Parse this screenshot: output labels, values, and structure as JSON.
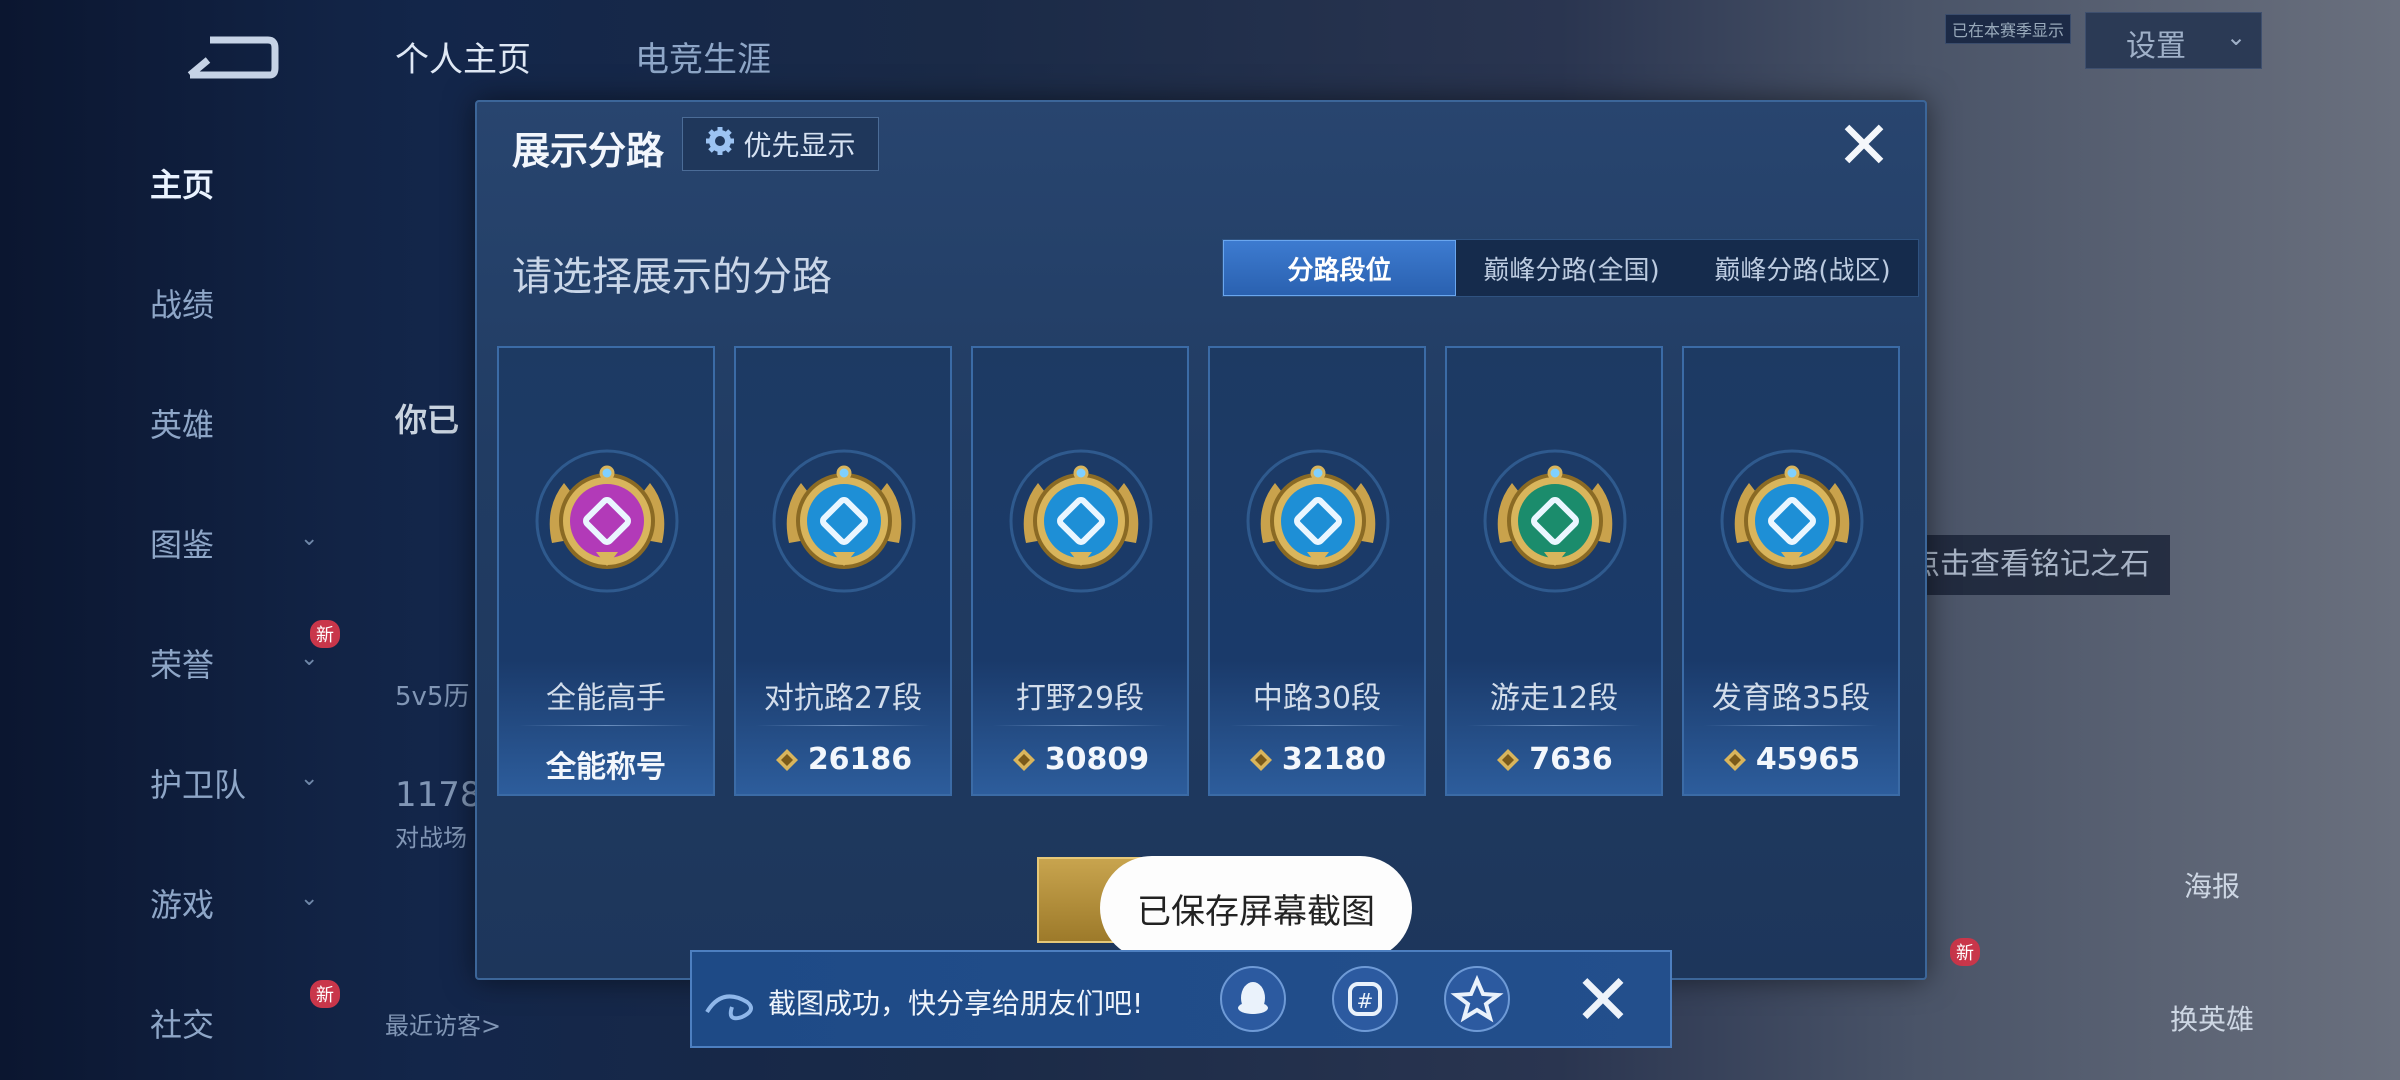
{
  "sidebar": {
    "items": [
      {
        "label": "主页",
        "active": true,
        "chevron": false
      },
      {
        "label": "战绩",
        "active": false,
        "chevron": false
      },
      {
        "label": "英雄",
        "active": false,
        "chevron": false
      },
      {
        "label": "图鉴",
        "active": false,
        "chevron": true
      },
      {
        "label": "荣誉",
        "active": false,
        "chevron": true,
        "badge": "新"
      },
      {
        "label": "护卫队",
        "active": false,
        "chevron": true
      },
      {
        "label": "游戏",
        "active": false,
        "chevron": true
      },
      {
        "label": "社交",
        "active": false,
        "chevron": false,
        "badge": "新"
      }
    ]
  },
  "header": {
    "tabs": [
      {
        "label": "个人主页"
      },
      {
        "label": "电竞生涯"
      }
    ],
    "settings_label": "设置",
    "sync_tag": "已在本赛季显示"
  },
  "background": {
    "partial_name": "你已",
    "history_label": "5v5历",
    "match_count": "1178",
    "match_label": "对战场",
    "recent_visitors": "最近访客>",
    "inscription_hint": "点击查看铭记之石",
    "poster_label": "海报",
    "change_hero_label": "换英雄",
    "new_badge": "新"
  },
  "modal": {
    "title": "展示分路",
    "priority_label": "优先显示",
    "prompt": "请选择展示的分路",
    "tabs": [
      {
        "label": "分路段位",
        "active": true
      },
      {
        "label": "巅峰分路(全国)",
        "active": false
      },
      {
        "label": "巅峰分路(战区)",
        "active": false
      }
    ],
    "lanes": [
      {
        "name": "全能高手",
        "score": "全能称号",
        "color": "#b23ab8",
        "icon": "all-round-icon",
        "has_gem": false
      },
      {
        "name": "对抗路27段",
        "score": "26186",
        "color": "#1e8fd6",
        "icon": "clash-lane-icon",
        "has_gem": true
      },
      {
        "name": "打野29段",
        "score": "30809",
        "color": "#1e8fd6",
        "icon": "jungle-icon",
        "has_gem": true
      },
      {
        "name": "中路30段",
        "score": "32180",
        "color": "#1e8fd6",
        "icon": "mid-lane-icon",
        "has_gem": true
      },
      {
        "name": "游走12段",
        "score": "7636",
        "color": "#1b8c6c",
        "icon": "roam-icon",
        "has_gem": true
      },
      {
        "name": "发育路35段",
        "score": "45965",
        "color": "#1e8fd6",
        "icon": "farm-lane-icon",
        "has_gem": true
      }
    ]
  },
  "toast": {
    "text": "已保存屏幕截图"
  },
  "share": {
    "text": "截图成功，快分享给朋友们吧!",
    "icons": [
      "qq-icon",
      "wechat-moments-icon",
      "qzone-icon"
    ]
  },
  "colors": {
    "accent": "#2a61b0",
    "gold": "#c8a44e",
    "modal_bg": "#213c63"
  }
}
